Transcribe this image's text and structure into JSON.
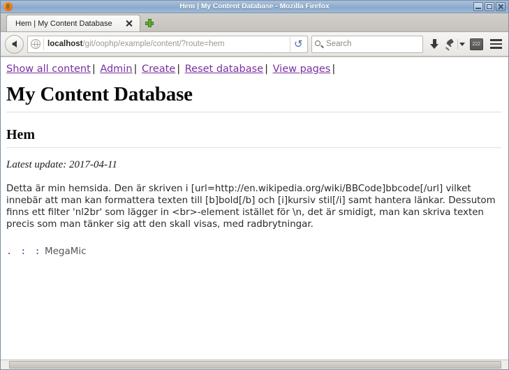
{
  "window": {
    "title": "Hem | My Content Database - Mozilla Firefox",
    "minimize_label": "Minimize",
    "maximize_label": "Maximize",
    "close_label": "Close"
  },
  "tabs": [
    {
      "title": "Hem | My Content Database",
      "close_label": "Close tab"
    }
  ],
  "new_tab_label": "Open a new tab",
  "toolbar": {
    "back_label": "Back",
    "url_host": "localhost",
    "url_path": "/git/oophp/example/content/?route=hem",
    "url_full": "localhost/git/oophp/example/content/?route=hem",
    "reload_glyph": "↻",
    "search_placeholder": "Search",
    "download_label": "Downloads",
    "pin_label": "Pin",
    "badge_text": "222",
    "menu_label": "Open menu"
  },
  "page": {
    "nav_links": [
      "Show all content",
      "Admin",
      "Create",
      "Reset database",
      "View pages"
    ],
    "nav_separator": "|",
    "site_title": "My Content Database",
    "page_heading": "Hem",
    "latest_update": "Latest update: 2017-04-11",
    "body_text": "Detta är min hemsida. Den är skriven i [url=http://en.wikipedia.org/wiki/BBCode]bbcode[/url] vilket innebär att man kan formattera texten till [b]bold[/b] och [i]kursiv stil[/i] samt hantera länkar. Dessutom finns ett filter 'nl2br' som lägger in <br>-element istället för \\n, det är smidigt, man kan skriva texten precis som man tänker sig att den skall visas, med radbrytningar.",
    "signature_dots": ". : :",
    "signature_name": "MegaMic"
  },
  "colors": {
    "link": "#7a2fa0",
    "titlebar": "#93b0d0",
    "text": "#2a2a2a"
  }
}
